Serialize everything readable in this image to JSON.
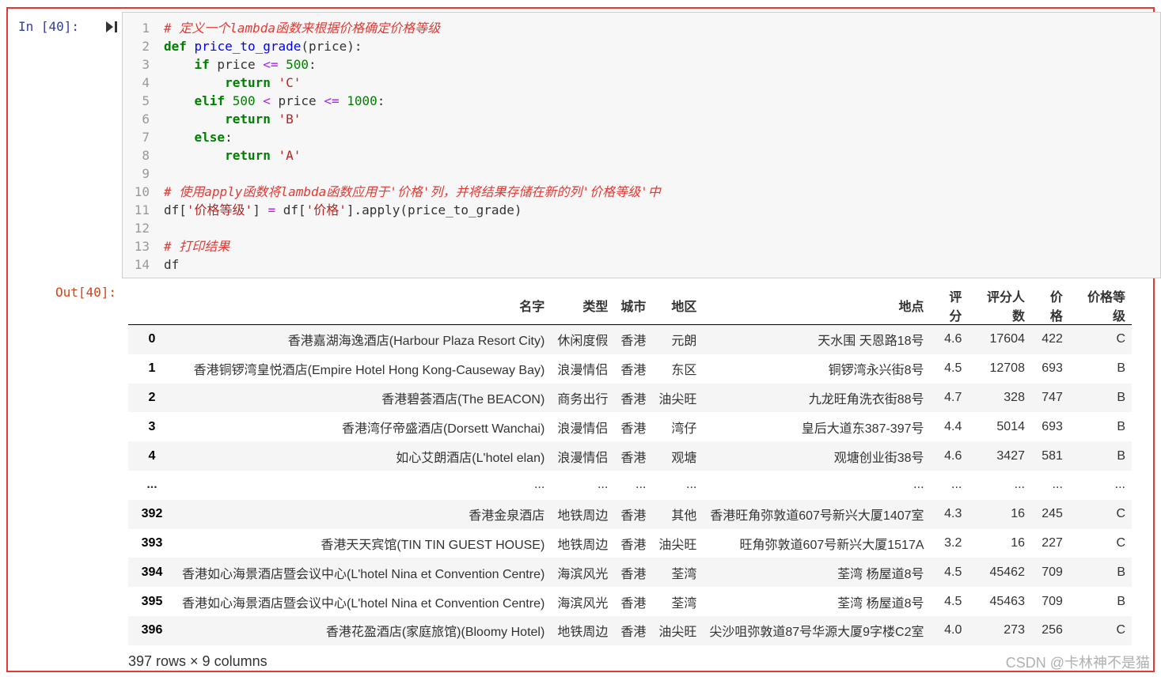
{
  "prompts": {
    "in": "In  [40]:",
    "out": "Out[40]:"
  },
  "code": {
    "line_numbers": [
      "1",
      "2",
      "3",
      "4",
      "5",
      "6",
      "7",
      "8",
      "9",
      "10",
      "11",
      "12",
      "13",
      "14"
    ],
    "l1": "# 定义一个lambda函数来根据价格确定价格等级",
    "l2_def": "def",
    "l2_name": "price_to_grade",
    "l2_rest": "(price):",
    "l3_if": "if",
    "l3_var": " price ",
    "l3_op": "<=",
    "l3_num": "500",
    "l3_colon": ":",
    "l4_ret": "return",
    "l4_str": "'C'",
    "l5_elif": "elif",
    "l5_num1": "500",
    "l5_op1": "<",
    "l5_var": " price ",
    "l5_op2": "<=",
    "l5_num2": "1000",
    "l5_colon": ":",
    "l6_ret": "return",
    "l6_str": "'B'",
    "l7_else": "else",
    "l7_colon": ":",
    "l8_ret": "return",
    "l8_str": "'A'",
    "l10": "# 使用apply函数将lambda函数应用于'价格'列，并将结果存储在新的列'价格等级'中",
    "l11_a": "df[",
    "l11_s1": "'价格等级'",
    "l11_b": "] ",
    "l11_op": "=",
    "l11_c": " df[",
    "l11_s2": "'价格'",
    "l11_d": "].apply(price_to_grade)",
    "l13": "# 打印结果",
    "l14": "df"
  },
  "table": {
    "columns": [
      "",
      "名字",
      "类型",
      "城市",
      "地区",
      "地点",
      "评分",
      "评分人数",
      "价格",
      "价格等级"
    ],
    "rows": [
      [
        "0",
        "香港嘉湖海逸酒店(Harbour Plaza Resort City)",
        "休闲度假",
        "香港",
        "元朗",
        "天水围 天恩路18号",
        "4.6",
        "17604",
        "422",
        "C"
      ],
      [
        "1",
        "香港铜锣湾皇悦酒店(Empire Hotel Hong Kong-Causeway Bay)",
        "浪漫情侣",
        "香港",
        "东区",
        "铜锣湾永兴街8号",
        "4.5",
        "12708",
        "693",
        "B"
      ],
      [
        "2",
        "香港碧荟酒店(The BEACON)",
        "商务出行",
        "香港",
        "油尖旺",
        "九龙旺角洗衣街88号",
        "4.7",
        "328",
        "747",
        "B"
      ],
      [
        "3",
        "香港湾仔帝盛酒店(Dorsett Wanchai)",
        "浪漫情侣",
        "香港",
        "湾仔",
        "皇后大道东387-397号",
        "4.4",
        "5014",
        "693",
        "B"
      ],
      [
        "4",
        "如心艾朗酒店(L'hotel elan)",
        "浪漫情侣",
        "香港",
        "观塘",
        "观塘创业街38号",
        "4.6",
        "3427",
        "581",
        "B"
      ],
      [
        "...",
        "...",
        "...",
        "...",
        "...",
        "...",
        "...",
        "...",
        "...",
        "..."
      ],
      [
        "392",
        "香港金泉酒店",
        "地铁周边",
        "香港",
        "其他",
        "香港旺角弥敦道607号新兴大厦1407室",
        "4.3",
        "16",
        "245",
        "C"
      ],
      [
        "393",
        "香港天天宾馆(TIN TIN GUEST HOUSE)",
        "地铁周边",
        "香港",
        "油尖旺",
        "旺角弥敦道607号新兴大厦1517A",
        "3.2",
        "16",
        "227",
        "C"
      ],
      [
        "394",
        "香港如心海景酒店暨会议中心(L'hotel Nina et Convention Centre)",
        "海滨风光",
        "香港",
        "荃湾",
        "荃湾 杨屋道8号",
        "4.5",
        "45462",
        "709",
        "B"
      ],
      [
        "395",
        "香港如心海景酒店暨会议中心(L'hotel Nina et Convention Centre)",
        "海滨风光",
        "香港",
        "荃湾",
        "荃湾 杨屋道8号",
        "4.5",
        "45463",
        "709",
        "B"
      ],
      [
        "396",
        "香港花盈酒店(家庭旅馆)(Bloomy Hotel)",
        "地铁周边",
        "香港",
        "油尖旺",
        "尖沙咀弥敦道87号华源大厦9字楼C2室",
        "4.0",
        "273",
        "256",
        "C"
      ]
    ]
  },
  "footer": "397 rows × 9 columns",
  "watermark": "CSDN @卡林神不是猫",
  "colors": {
    "frame": "#e53935",
    "in_prompt": "#303f9f",
    "out_prompt": "#d84315",
    "comment": "#e53935"
  }
}
